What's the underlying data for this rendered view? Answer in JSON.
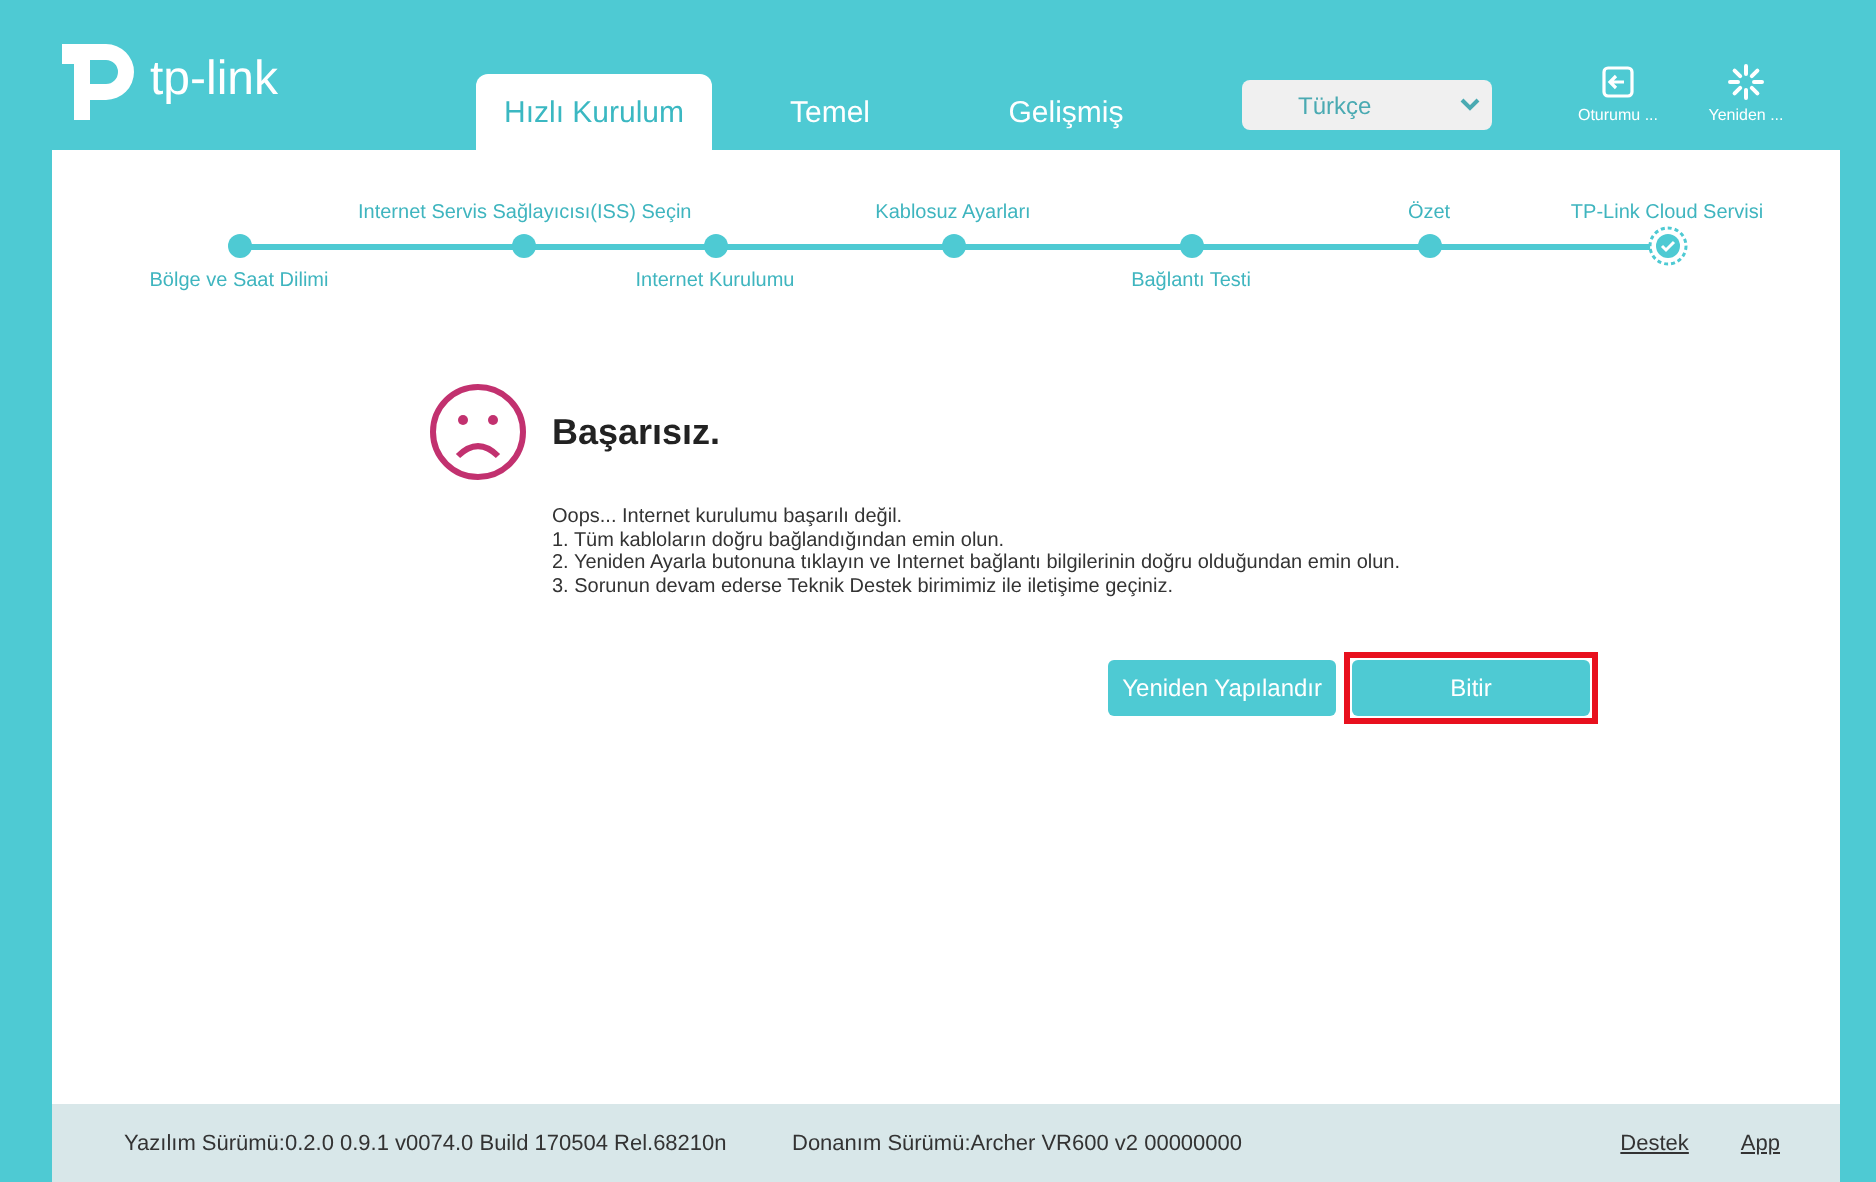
{
  "header": {
    "logo": "tp-link",
    "tabs": [
      {
        "label": "Hızlı Kurulum",
        "selected": true
      },
      {
        "label": "Temel",
        "selected": false
      },
      {
        "label": "Gelişmiş",
        "selected": false
      }
    ],
    "language": {
      "value": "Türkçe"
    },
    "actions": [
      {
        "kind": "logout",
        "label": "Oturumu ..."
      },
      {
        "kind": "reboot",
        "label": "Yeniden ..."
      }
    ]
  },
  "steps": [
    {
      "label": "Bölge ve Saat Dilimi",
      "current": false
    },
    {
      "label": "Internet Servis Sağlayıcısı(ISS) Seçin",
      "current": false
    },
    {
      "label": "Internet Kurulumu",
      "current": false
    },
    {
      "label": "Kablosuz Ayarları",
      "current": false
    },
    {
      "label": "Bağlantı Testi",
      "current": false
    },
    {
      "label": "Özet",
      "current": false
    },
    {
      "label": "TP-Link Cloud Servisi",
      "current": true
    }
  ],
  "result": {
    "title": "Başarısız.",
    "lines": [
      "Oops... Internet kurulumu başarılı değil.",
      "1. Tüm kabloların doğru bağlandığından emin olun.",
      "2. Yeniden Ayarla butonuna tıklayın ve Internet bağlantı bilgilerinin doğru olduğundan emin olun.",
      "3. Sorunun devam ederse Teknik Destek birimimiz ile iletişime geçiniz."
    ],
    "buttons": [
      {
        "label": "Yeniden Yapılandır",
        "highlighted": false
      },
      {
        "label": "Bitir",
        "highlighted": true
      }
    ]
  },
  "footer": {
    "software": "Yazılım Sürümü:0.2.0 0.9.1 v0074.0 Build 170504 Rel.68210n",
    "hardware": "Donanım Sürümü:Archer VR600 v2 00000000",
    "links": [
      "Destek",
      "App"
    ]
  }
}
